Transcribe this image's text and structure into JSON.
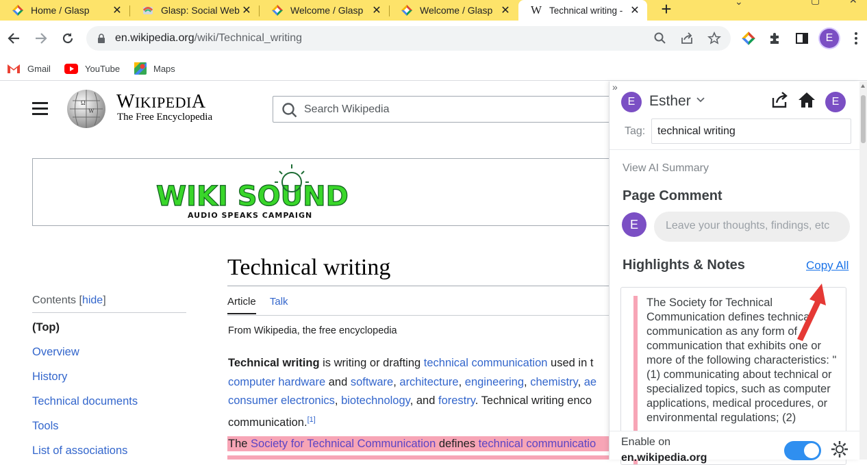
{
  "browser": {
    "tabs": [
      {
        "title": "Home / Glasp",
        "icon": "glasp-icon"
      },
      {
        "title": "Glasp: Social Web",
        "icon": "glasp-social-icon"
      },
      {
        "title": "Welcome / Glasp",
        "icon": "glasp-icon"
      },
      {
        "title": "Welcome / Glasp",
        "icon": "glasp-icon"
      },
      {
        "title": "Technical writing -",
        "icon": "wikipedia-icon",
        "active": true
      }
    ],
    "url_host": "en.wikipedia.org",
    "url_path": "/wiki/Technical_writing",
    "profile_initial": "E",
    "bookmarks": [
      "Gmail",
      "YouTube",
      "Maps"
    ]
  },
  "wiki": {
    "wordmark_big_w": "W",
    "wordmark_rest": "IKIPEDI",
    "wordmark_end": "A",
    "tagline": "The Free Encyclopedia",
    "search_placeholder": "Search Wikipedia",
    "banner": {
      "line1": "WIKI SOUND",
      "line2": "AUDIO SPEAKS CAMPAIGN"
    },
    "contents_label": "Contents",
    "contents_hide": "hide",
    "toc": [
      "(Top)",
      "Overview",
      "History",
      "Technical documents",
      "Tools",
      "List of associations"
    ],
    "article_title": "Technical writing",
    "tab_article": "Article",
    "tab_talk": "Talk",
    "from_line": "From Wikipedia, the free encyclopedia",
    "para": {
      "bold": "Technical writing",
      "t1": " is writing or drafting ",
      "l1": "technical communication",
      "t2": " used in t",
      "l2": "computer hardware",
      "t3": " and ",
      "l3": "software",
      "c1": ", ",
      "l4": "architecture",
      "c2": ", ",
      "l5": "engineering",
      "c3": ", ",
      "l6": "chemistry",
      "c4": ", ",
      "l7": "ae",
      "l8": "consumer electronics",
      "c5": ", ",
      "l9": "biotechnology",
      "t4": ", and ",
      "l10": "forestry",
      "t5": ". Technical writing enco",
      "t6": "communication.",
      "sup": "[1]"
    },
    "highlight": {
      "t1": "The ",
      "l1": "Society for Technical Communication",
      "t2": " defines ",
      "l2": "technical communicatio"
    }
  },
  "glasp": {
    "user_initial": "E",
    "user_name": "Esther",
    "tag_label": "Tag:",
    "tag_value": "technical writing",
    "view_ai_summary": "View AI Summary",
    "page_comment": "Page Comment",
    "comment_placeholder": "Leave your thoughts, findings, etc",
    "highlights_title": "Highlights & Notes",
    "copy_all": "Copy All",
    "highlight_text": "The Society for Technical Communication defines technical communication as any form of communication that exhibits one or more of the following characteristics: \"(1) communicating about technical or specialized topics, such as computer applications, medical procedures, or environmental regulations; (2)",
    "enable_label": "Enable on",
    "enable_domain": "en.wikipedia.org",
    "enabled": true,
    "accent": "#7b4fc4",
    "highlight_color": "#f7a5b6"
  }
}
